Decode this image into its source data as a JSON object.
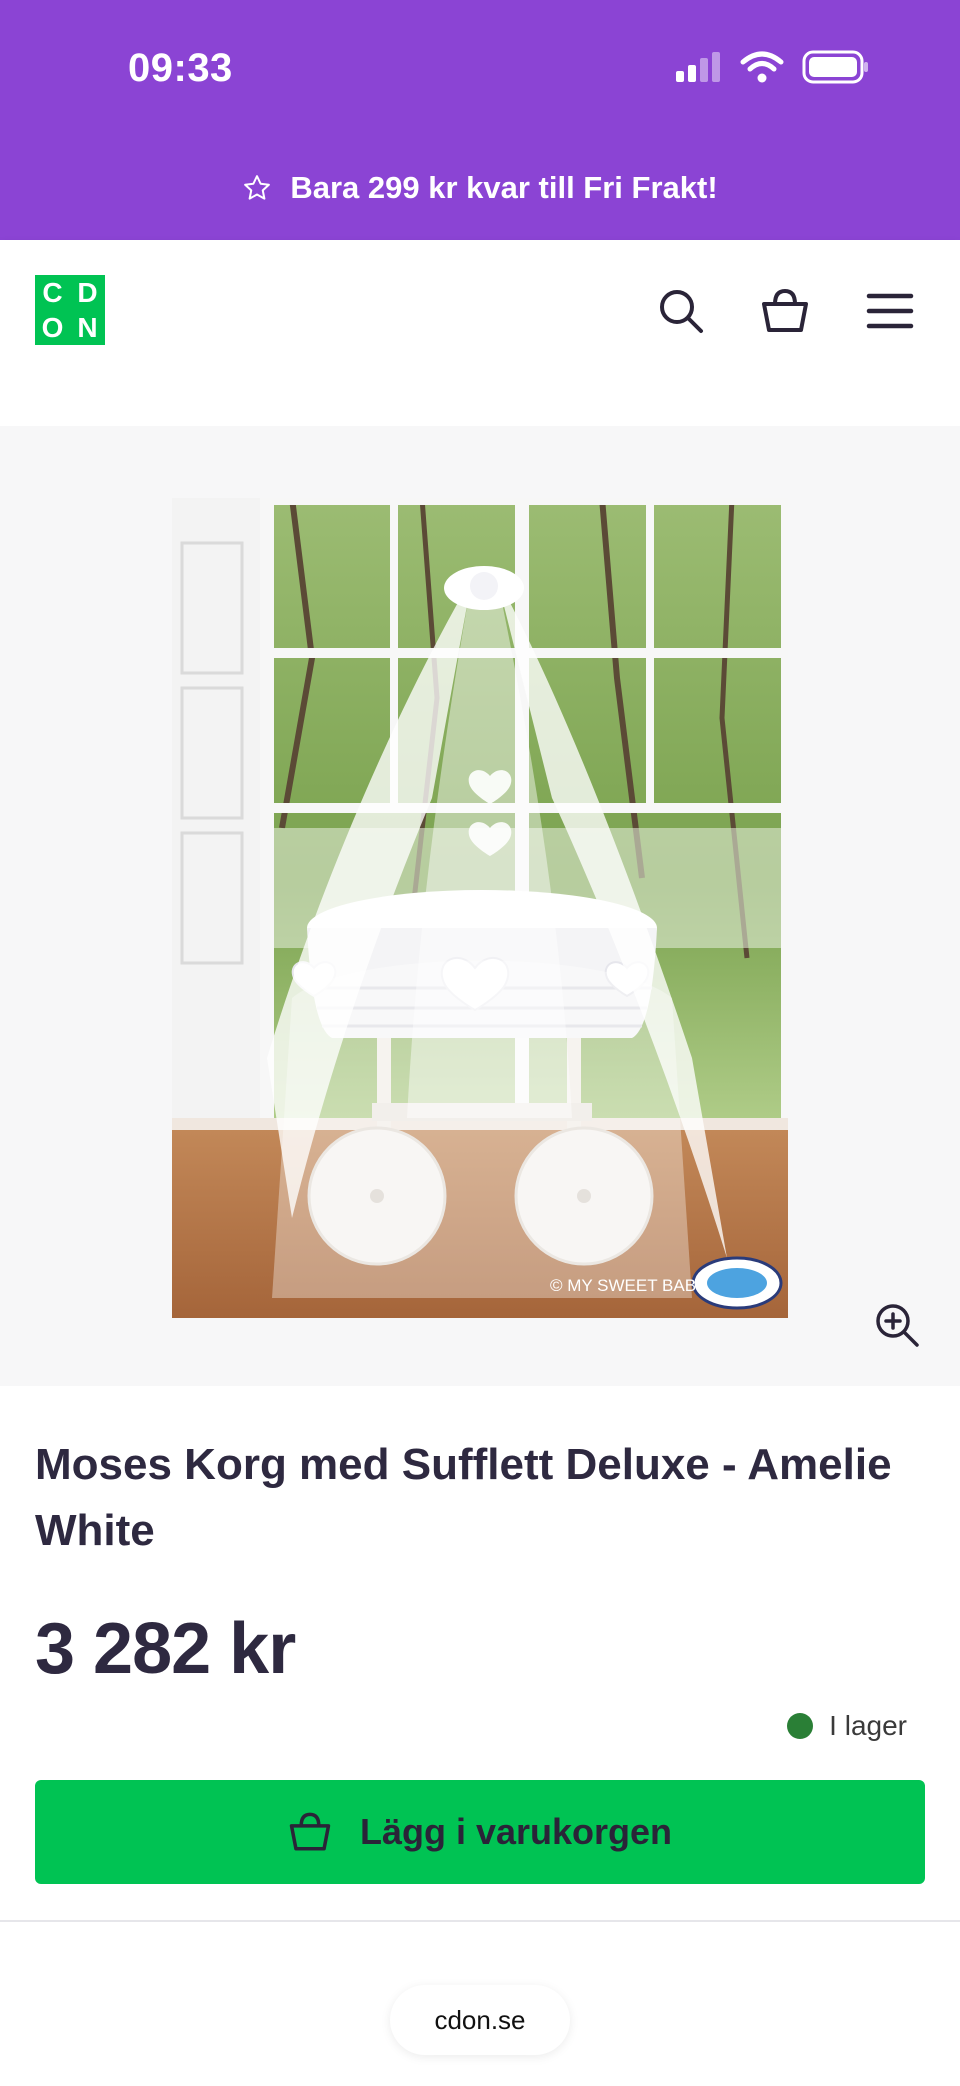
{
  "status_bar": {
    "time": "09:33"
  },
  "promo": {
    "text": "Bara 299 kr kvar till Fri Frakt!",
    "icon": "star-outline-icon"
  },
  "header": {
    "logo_letters": [
      "C",
      "D",
      "O",
      "N"
    ],
    "icons": [
      "search-icon",
      "basket-icon",
      "menu-icon"
    ]
  },
  "product": {
    "image_alt": "Moses Korg med Sufflett Deluxe - Amelie White",
    "image_watermark": "© MY SWEET BABY",
    "title": "Moses Korg med Sufflett Deluxe - Amelie White",
    "price": "3 282 kr",
    "stock": "I lager",
    "add_to_cart_label": "Lägg i varukorgen"
  },
  "browser": {
    "url": "cdon.se"
  },
  "colors": {
    "topbar": "#8b44d4",
    "brand_green": "#00c353",
    "stock_green": "#2a7f36",
    "text_dark": "#2e2940"
  }
}
